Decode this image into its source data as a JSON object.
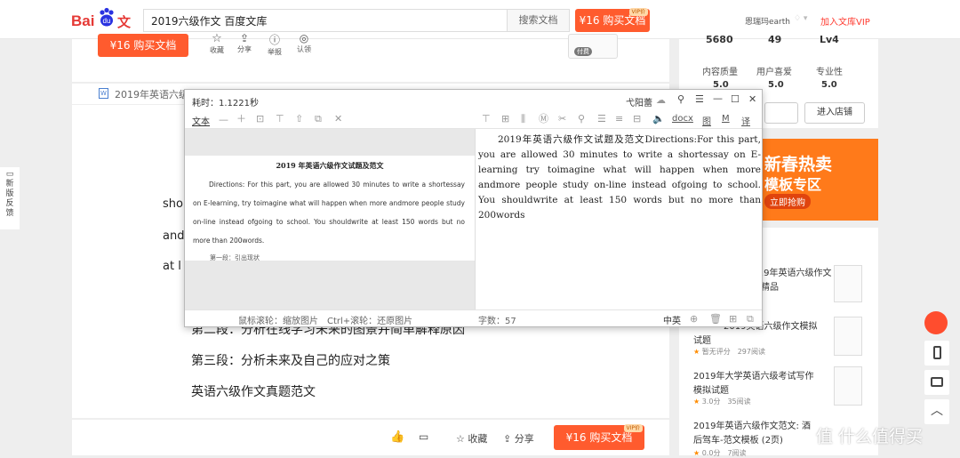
{
  "header": {
    "logo_bai": "Bai",
    "logo_wk": "文库",
    "search_value": "2019六级作文 百度文库",
    "search_button": "搜索文档",
    "buy_button": "¥16 购买文档",
    "vip_badge": "VIP价",
    "user_name": "恩瑞玛earth",
    "join_vip": "加入文库VIP"
  },
  "actions": {
    "buy_button": "¥16 购买文档",
    "collect": "收藏",
    "share": "分享",
    "report": "举报",
    "certify": "认领",
    "paid": "付费"
  },
  "stats": {
    "v1": "5680",
    "v2": "49",
    "v3": "Lv4",
    "l1": "内容质量",
    "l2": "用户喜爱",
    "l3": "专业性",
    "s1": "5.0",
    "s2": "5.0",
    "s3": "5.0",
    "enter_shop": "进入店铺"
  },
  "banner": {
    "line1": "新春热卖",
    "line2": "模板专区",
    "line3": "立即抢购"
  },
  "doc": {
    "tab_title": "2019年英语六级",
    "frag1": "shor",
    "frag2": "and",
    "frag3": "at l",
    "line2": "第二段：分析在线学习未来的图景并简单解释原因",
    "line3": "第三段：分析未来及自己的应对之策",
    "line4": "英语六级作文真题范文"
  },
  "feedback": "新版反馈",
  "bottom": {
    "collect": "收藏",
    "share": "分享",
    "buy_button": "¥16 购买文档",
    "vip_badge": "VIP价"
  },
  "ocr": {
    "time_label": "耗时：1.1221秒",
    "user": "弋阳蕾",
    "text_tab": "文本",
    "docx": "docx",
    "tu": "图",
    "m": "M",
    "yi": "译",
    "page_title": "2019 年英语六级作文试题及范文",
    "page_body": "Directions: For this part, you are allowed 30 minutes to write a shortessay on E-learning, try toimagine what will happen when more andmore people study on-line instead ofgoing to school. You shouldwrite at least 150 words but no more than 200words.",
    "page_cut": "第一段：引出现状",
    "result_text": "2019年英语六级作文试题及范文Directions:For this part, you are allowed 30 minutes to write a shortessay on E-learning try toimagine what will happen when more andmore people study on-line instead ofgoing to school. You shouldwrite at least 150 words but no more than 200words",
    "hint": "鼠标滚轮：缩放图片　Ctrl+滚轮：还原图片",
    "count": "字数：57",
    "lang": "中英"
  },
  "sidebar": {
    "items": [
      {
        "title": "2019年英语六级作文",
        "title2": "精品"
      },
      {
        "title": "2019英语六级作文模拟",
        "title2": "试题",
        "rating": "暂无评分",
        "reads": "297阅读"
      },
      {
        "title": "2019年大学英语六级考试写作",
        "title2": "模拟试题",
        "rating": "3.0分",
        "reads": "35阅读"
      },
      {
        "title": "2019年英语六级作文范文: 酒",
        "title2": "后驾车-范文模板 (2页)",
        "rating": "0.0分",
        "reads": "7阅读"
      }
    ]
  },
  "watermark": "值 什么值得买"
}
